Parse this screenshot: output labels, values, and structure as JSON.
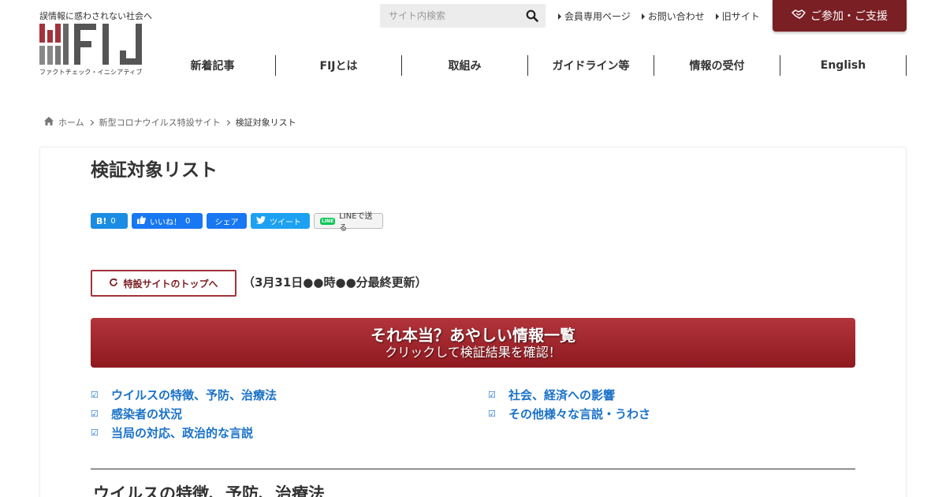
{
  "header": {
    "tagline": "誤情報に惑わされない社会へ",
    "logo_text": "FIJ",
    "logo_subtext": "ファクトチェック・イニシアティブ",
    "search_placeholder": "サイト内検索",
    "top_links": [
      "会員専用ページ",
      "お問い合わせ",
      "旧サイト"
    ],
    "support_button": "ご参加・ご支援",
    "nav": [
      "新着記事",
      "FIJとは",
      "取組み",
      "ガイドライン等",
      "情報の受付",
      "English"
    ]
  },
  "breadcrumb": [
    "ホーム",
    "新型コロナウイルス特設サイト",
    "検証対象リスト"
  ],
  "page": {
    "title": "検証対象リスト",
    "share": {
      "hatena_label": "B!",
      "hatena_count": "0",
      "fb_like_label": "いいね！",
      "fb_like_count": "0",
      "share_label": "シェア",
      "tweet_label": "ツイート",
      "line_label": "LINEで送る"
    },
    "top_link_label": "特設サイトのトップへ",
    "updated_text": "（3月31日●●時●●分最終更新）",
    "banner": {
      "line1": "それ本当？あやしい情報一覧",
      "line2": "クリックして検証結果を確認！"
    },
    "toc": [
      "ウイルスの特徴、予防、治療法",
      "社会、経済への影響",
      "感染者の状況",
      "その他様々な言説・うわさ",
      "当局の対応、政治的な言説"
    ],
    "toc_check_glyph": "☑",
    "section_heading": "ウイルスの特徴、予防、治療法"
  },
  "colors": {
    "brand": "#7a1f24",
    "link": "#1a72c9",
    "banner_top": "#b3343b",
    "banner_bottom": "#8e1a20"
  }
}
